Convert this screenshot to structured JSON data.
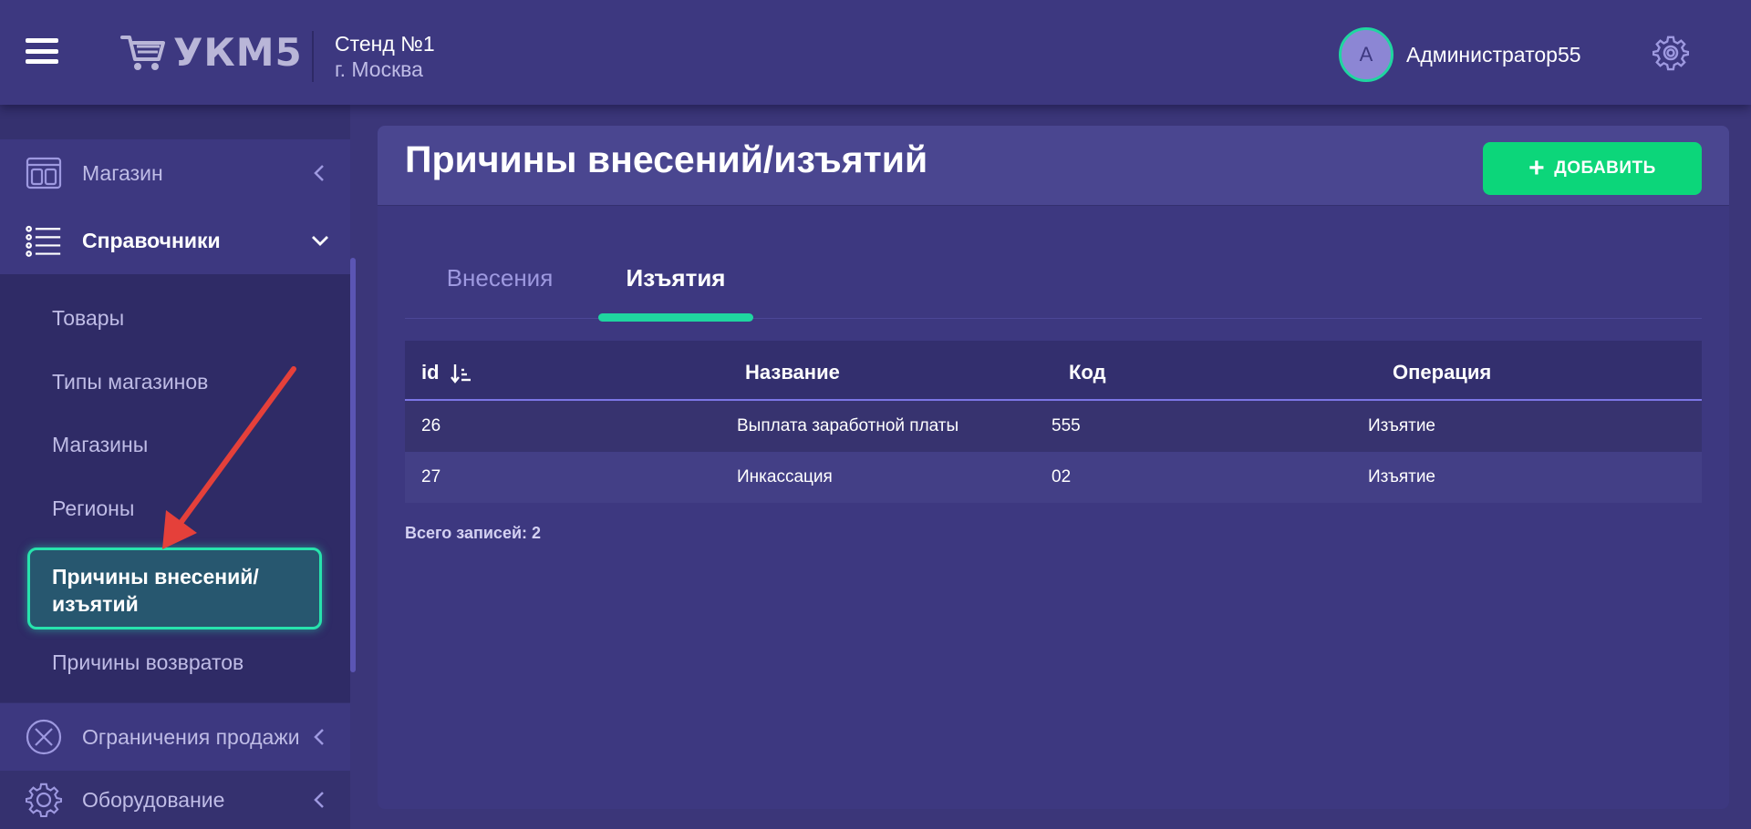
{
  "header": {
    "logo_text": "УКМ5",
    "stand_name": "Стенд №1",
    "stand_city": "г. Москва",
    "user_initial": "A",
    "user_name": "Администратор55"
  },
  "sidebar": {
    "groups": [
      {
        "label": "Магазин",
        "icon": "store-icon",
        "expanded": false
      },
      {
        "label": "Справочники",
        "icon": "list-icon",
        "expanded": true
      },
      {
        "label": "Ограничения продажи",
        "icon": "cancel-circle-icon",
        "expanded": false
      },
      {
        "label": "Оборудование",
        "icon": "gear-icon",
        "expanded": false
      }
    ],
    "subitems": [
      "Товары",
      "Типы магазинов",
      "Магазины",
      "Регионы",
      "Причины внесений/ изъятий",
      "Причины возвратов"
    ],
    "active_subitem_line1": "Причины внесений/",
    "active_subitem_line2": "изъятий"
  },
  "page": {
    "title": "Причины внесений/изъятий",
    "add_button": "ДОБАВИТЬ",
    "tabs": [
      {
        "label": "Внесения",
        "active": false
      },
      {
        "label": "Изъятия",
        "active": true
      }
    ]
  },
  "table": {
    "columns": [
      "id",
      "Название",
      "Код",
      "Операция"
    ],
    "rows": [
      {
        "id": "26",
        "name": "Выплата заработной платы",
        "code": "555",
        "operation": "Изъятие"
      },
      {
        "id": "27",
        "name": "Инкассация",
        "code": "02",
        "operation": "Изъятие"
      }
    ],
    "total": "Всего записей: 2"
  },
  "colors": {
    "accent_green": "#0cd67a",
    "teal": "#1fd6a0",
    "background": "#3b3679",
    "annotation_arrow": "#e5403a"
  }
}
